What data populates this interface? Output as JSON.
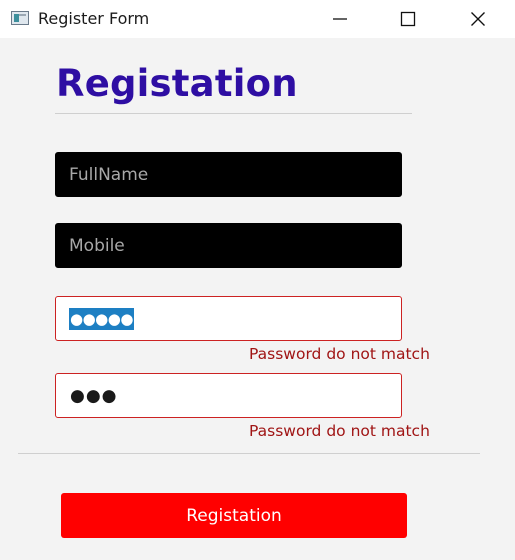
{
  "window": {
    "title": "Register Form",
    "controls": [
      "minimize",
      "maximize",
      "close"
    ]
  },
  "form": {
    "heading": "Registation",
    "fullname": {
      "placeholder": "FullName",
      "value": ""
    },
    "mobile": {
      "placeholder": "Mobile",
      "value": ""
    },
    "password": {
      "masked": "●●●●●",
      "selected": true,
      "error": "Password do not match"
    },
    "confirm_password": {
      "masked": "●●●",
      "error": "Password do not match"
    },
    "submit_label": "Registation"
  },
  "colors": {
    "heading": "#2e0ea3",
    "input_dark_bg": "#000000",
    "error_border": "#cc2222",
    "error_text": "#a01515",
    "submit_bg": "#ff0000",
    "selection": "#1d7fc3"
  }
}
